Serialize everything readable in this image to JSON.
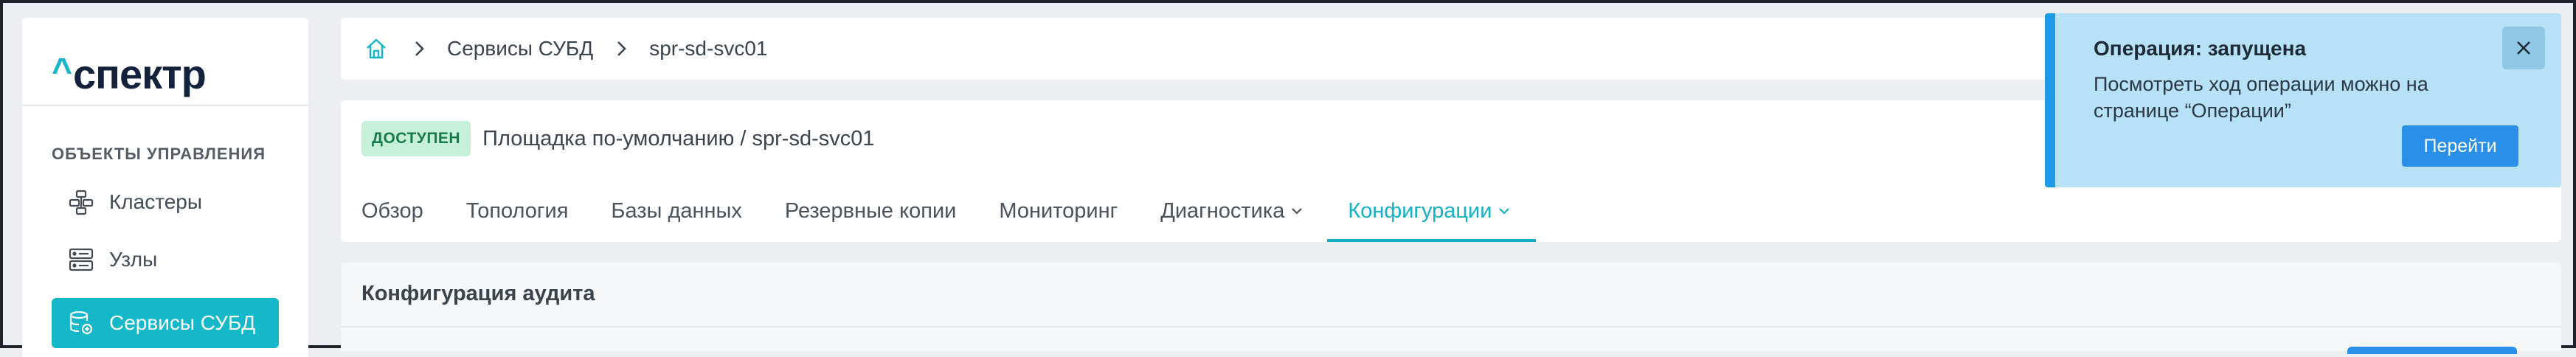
{
  "app": {
    "logo_caret": "^",
    "logo_text": "спектр"
  },
  "sidebar": {
    "section_title": "ОБЪЕКТЫ УПРАВЛЕНИЯ",
    "items": [
      {
        "label": "Кластеры",
        "icon": "cluster-icon",
        "active": false
      },
      {
        "label": "Узлы",
        "icon": "server-icon",
        "active": false
      },
      {
        "label": "Сервисы СУБД",
        "icon": "database-service-icon",
        "active": true
      }
    ]
  },
  "breadcrumb": {
    "home_icon": "home-icon",
    "items": [
      "Сервисы СУБД",
      "spr-sd-svc01"
    ]
  },
  "service": {
    "status": "ДОСТУПЕН",
    "path": "Площадка по-умолчанию /  spr-sd-svc01"
  },
  "tabs": [
    {
      "label": "Обзор",
      "dropdown": false,
      "active": false
    },
    {
      "label": "Топология",
      "dropdown": false,
      "active": false
    },
    {
      "label": "Базы данных",
      "dropdown": false,
      "active": false
    },
    {
      "label": "Резервные копии",
      "dropdown": false,
      "active": false
    },
    {
      "label": "Мониторинг",
      "dropdown": false,
      "active": false
    },
    {
      "label": "Диагностика",
      "dropdown": true,
      "active": false
    },
    {
      "label": "Конфигурации",
      "dropdown": true,
      "active": true
    }
  ],
  "section": {
    "title": "Конфигурация аудита"
  },
  "toast": {
    "title": "Операция: запущена",
    "message": "Посмотреть ход операции можно на странице “Операции”",
    "action_label": "Перейти",
    "close_icon": "close-icon"
  },
  "colors": {
    "accent": "#14b8c8",
    "status_bg": "#c7f0da",
    "status_text": "#18794a",
    "toast_bg": "#b6e1f6",
    "toast_border": "#1f9ae8",
    "primary_button": "#2a8fe8"
  }
}
